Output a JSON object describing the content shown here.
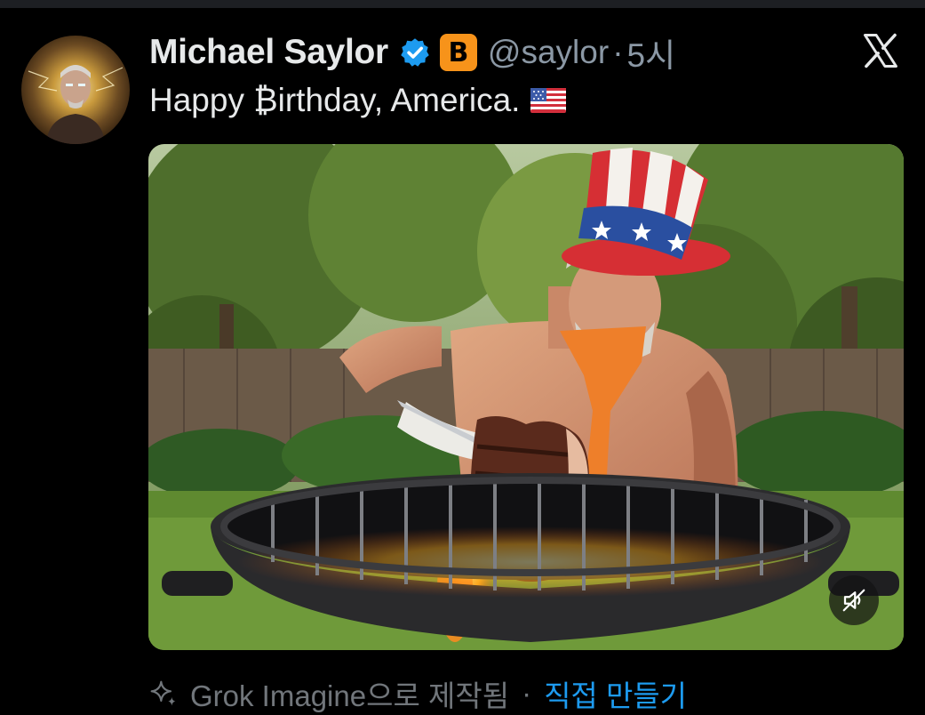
{
  "post": {
    "author_name": "Michael Saylor",
    "author_handle": "@saylor",
    "separator": "·",
    "timestamp": "5시",
    "badge_symbol": "B",
    "text": "Happy ₿irthday, America.",
    "verified_color": "#1d9bf0",
    "badge_color": "#f7931a"
  },
  "icons": {
    "verified": "verified-check-icon",
    "badge": "bitcoin-badge-icon",
    "close": "x-logo-icon",
    "flag": "us-flag-emoji",
    "mute": "speaker-muted-icon",
    "sparkle": "sparkle-icon"
  },
  "footer": {
    "generated_label": "Grok Imagine으로 제작됨",
    "separator": "·",
    "make_your_own": "직접 만들기",
    "link_color": "#1d9bf0"
  }
}
